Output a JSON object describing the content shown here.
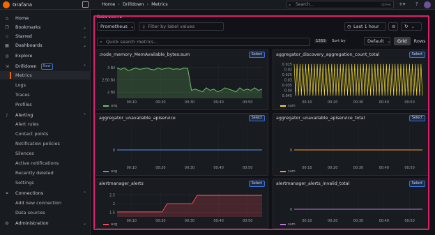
{
  "app": {
    "name": "Grafana"
  },
  "breadcrumb": [
    "Home",
    "Drilldown",
    "Metrics"
  ],
  "search": {
    "placeholder": "Search...",
    "shortcut": "ctrl+k"
  },
  "sidebar": {
    "items": [
      {
        "label": "Home",
        "icon": "home-icon"
      },
      {
        "label": "Bookmarks",
        "icon": "bookmark-icon",
        "expandable": true
      },
      {
        "label": "Starred",
        "icon": "star-icon",
        "expandable": true
      },
      {
        "label": "Dashboards",
        "icon": "apps-icon",
        "expandable": true
      },
      {
        "label": "Explore",
        "icon": "compass-icon"
      },
      {
        "label": "Drilldown",
        "icon": "drilldown-icon",
        "expanded": true,
        "badge": "New"
      },
      {
        "label": "Metrics",
        "sub": true,
        "active": true
      },
      {
        "label": "Logs",
        "sub": true
      },
      {
        "label": "Traces",
        "sub": true
      },
      {
        "label": "Profiles",
        "sub": true
      },
      {
        "label": "Alerting",
        "icon": "bell-icon",
        "expanded": true
      },
      {
        "label": "Alert rules",
        "sub": true
      },
      {
        "label": "Contact points",
        "sub": true
      },
      {
        "label": "Notification policies",
        "sub": true
      },
      {
        "label": "Silences",
        "sub": true
      },
      {
        "label": "Active notifications",
        "sub": true
      },
      {
        "label": "Recently deleted",
        "sub": true
      },
      {
        "label": "Settings",
        "sub": true
      },
      {
        "label": "Connections",
        "icon": "link-icon",
        "expanded": true
      },
      {
        "label": "Add new connection",
        "sub": true
      },
      {
        "label": "Data sources",
        "sub": true
      },
      {
        "label": "Administration",
        "icon": "gear-icon",
        "expandable": true
      }
    ]
  },
  "controls": {
    "datasource_label": "Data source",
    "datasource": "Prometheus",
    "filter_placeholder": "Filter by label values",
    "time_range": "Last 1 hour",
    "quick_search_placeholder": "Quick search metrics...",
    "metric_count": "1559",
    "sort_label": "Sort by",
    "sort_value": "Default",
    "view_grid": "Grid",
    "view_rows": "Rows"
  },
  "colors": {
    "accent": "#f46800",
    "highlight": "#e01f6c",
    "green": "#73bf69",
    "yellow": "#fade2a",
    "blue": "#5794f2",
    "orange": "#ff9830",
    "purple": "#b877d9",
    "red": "#f2495c"
  },
  "panels": [
    {
      "title": ":node_memory_MemAvailable_bytes:sum",
      "select": "Select",
      "legend": "avg",
      "color": "#73bf69",
      "chart_data": {
        "type": "area",
        "x_ticks": [
          "00:10",
          "00:20",
          "00:30",
          "00:40",
          "00:50"
        ],
        "y_ticks": [
          "2 Bil",
          "2.50 Bil",
          "3 Bil"
        ],
        "ylim": [
          1.8,
          3.2
        ],
        "series": [
          {
            "name": "avg",
            "values": [
              2.95,
              2.9,
              2.95,
              2.85,
              2.9,
              2.95,
              2.9,
              2.92,
              2.95,
              2.9,
              2.88,
              2.95,
              2.9,
              2.93,
              2.95,
              2.9,
              2.92,
              2.9,
              2.95,
              2.93,
              2.1,
              2.15,
              2.1,
              2.05,
              2.2,
              2.1,
              2.15,
              2.05,
              2.1,
              2.2,
              2.15,
              2.1,
              2.05,
              2.2,
              2.1,
              2.15,
              2.1,
              2.2,
              2.1,
              2.15
            ]
          }
        ]
      }
    },
    {
      "title": "aggregator_discovery_aggregation_count_total",
      "select": "Select",
      "legend": "sum",
      "color": "#fade2a",
      "chart_data": {
        "type": "line",
        "x_ticks": [
          "00:10",
          "00:20",
          "00:30",
          "00:40",
          "00:50"
        ],
        "y_ticks": [
          "0.045",
          "0.04",
          "0.035",
          "0.03",
          "0.025",
          "0.02",
          "0.015"
        ],
        "ylim": [
          0.012,
          0.046
        ],
        "series": [
          {
            "name": "sum",
            "values": "oscillating"
          }
        ]
      }
    },
    {
      "title": "aggregator_unavailable_apiservice",
      "select": "Select",
      "legend": "avg",
      "color": "#5794f2",
      "chart_data": {
        "type": "line",
        "x_ticks": [
          "00:10",
          "00:20",
          "00:30",
          "00:40",
          "00:50"
        ],
        "y_ticks": [
          "0"
        ],
        "series": [
          {
            "name": "avg",
            "values": [
              0,
              0,
              0,
              0,
              0,
              0
            ]
          }
        ]
      }
    },
    {
      "title": "aggregator_unavailable_apiservice_total",
      "select": "Select",
      "legend": "sum",
      "color": "#ff9830",
      "chart_data": {
        "type": "line",
        "x_ticks": [
          "00:10",
          "00:20",
          "00:30",
          "00:40",
          "00:50"
        ],
        "y_ticks": [
          "0"
        ],
        "series": [
          {
            "name": "sum",
            "values": [
              0,
              0,
              0,
              0,
              0,
              0
            ]
          }
        ]
      }
    },
    {
      "title": "alertmanager_alerts",
      "select": "Select",
      "legend": "avg",
      "color": "#f2495c",
      "chart_data": {
        "type": "area",
        "x_ticks": [
          "00:10",
          "00:20",
          "00:30",
          "00:40",
          "00:50"
        ],
        "y_ticks": [
          "1.5",
          "2",
          "2.5"
        ],
        "ylim": [
          1.2,
          2.8
        ],
        "series": [
          {
            "name": "avg",
            "values": [
              1.5,
              1.5,
              1.5,
              1.5,
              1.5,
              1.5,
              1.5,
              1.5,
              1.5,
              1.5,
              2,
              2,
              2,
              2,
              2,
              2,
              2.5,
              2.5,
              2.5,
              2.5,
              2.5,
              2.5,
              2.5,
              2.5,
              2.5,
              2.5,
              2.5,
              2.5,
              2.5,
              2.5
            ]
          }
        ]
      }
    },
    {
      "title": "alertmanager_alerts_invalid_total",
      "select": "Select",
      "legend": "sum",
      "color": "#b877d9",
      "chart_data": {
        "type": "line",
        "x_ticks": [
          "00:10",
          "00:20",
          "00:30",
          "00:40",
          "00:50"
        ],
        "y_ticks": [
          "0"
        ],
        "series": [
          {
            "name": "sum",
            "values": [
              0,
              0,
              0,
              0,
              0,
              0
            ]
          }
        ]
      }
    }
  ]
}
